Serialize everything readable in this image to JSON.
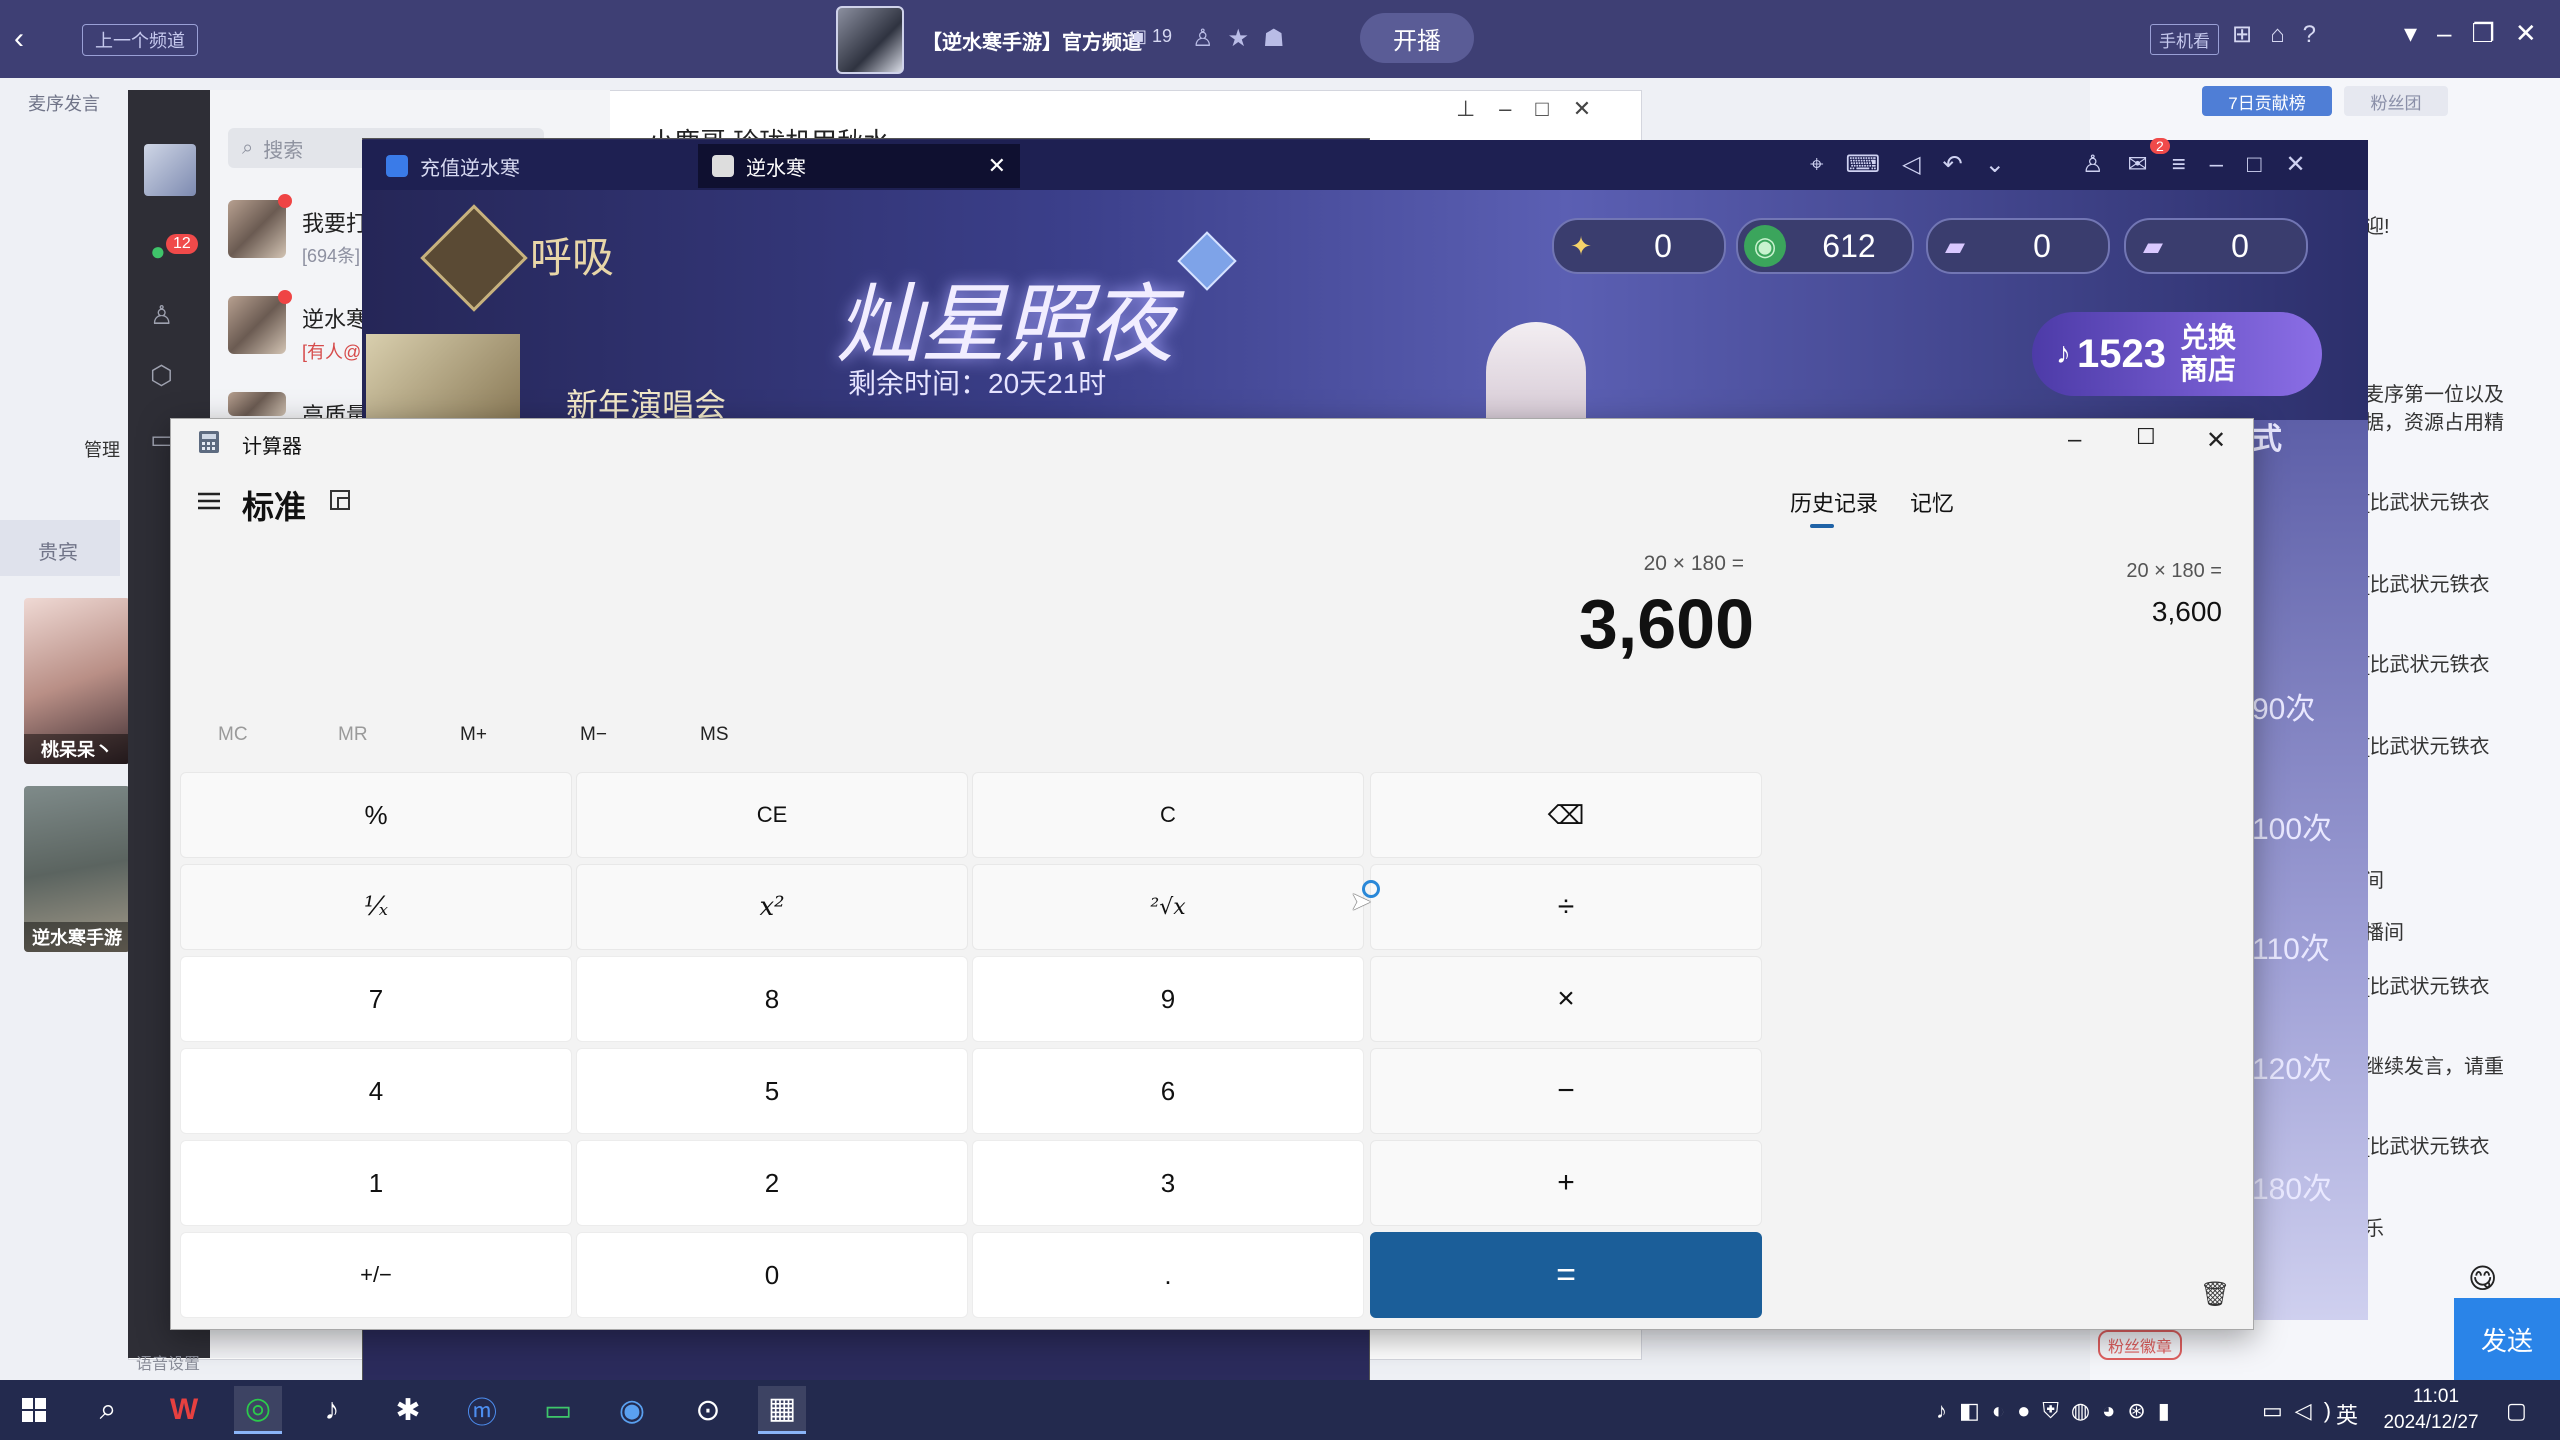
{
  "topbar": {
    "prev_channel": "上一个频道",
    "channel_title": "【逆水寒手游】官方频道",
    "channel_count": "19",
    "live_label": "开播",
    "mobile_label": "手机看"
  },
  "left_panel": {
    "speak_label": "麦序发言",
    "manage_label": "管理",
    "vip_label": "贵宾",
    "thumbs": [
      "桃呆呆丶",
      "逆水寒手游"
    ]
  },
  "messenger": {
    "search_placeholder": "搜索",
    "badge": "12",
    "items": [
      {
        "name": "我要打",
        "sub": "[694条]"
      },
      {
        "name": "逆水寒",
        "sub": "[有人@"
      },
      {
        "name": "高质量",
        "sub": ""
      }
    ],
    "chat_title": "小鹿哥 玲珑机甲秋水",
    "voice_settings": "语音设置"
  },
  "rightcol": {
    "tab_contrib": "7日贡献榜",
    "tab_fans": "粉丝团",
    "lines": [
      "迎!",
      "麦序第一位以及",
      "据，资源占用精",
      "[比武状元铁衣",
      "[比武状元铁衣",
      "[比武状元铁衣",
      "[比武状元铁衣",
      "间",
      "播间",
      "[比武状元铁衣",
      "继续发言，请重",
      "[比武状元铁衣",
      "乐"
    ],
    "fans_badge": "粉丝徽章",
    "send_label": "发送"
  },
  "game": {
    "tab_recharge": "充值逆水寒",
    "tab_game": "逆水寒",
    "mail_badge": "2",
    "banner_title": "灿星照夜",
    "banner_sub": "剩余时间：20天21时",
    "breath_label": "呼吸",
    "newyear_label": "新年演唱会",
    "right_label": "式",
    "currencies": [
      "0",
      "612",
      "0",
      "0"
    ],
    "shop_value": "1523",
    "shop_label_1": "兑换",
    "shop_label_2": "商店",
    "side_counts": [
      "90次",
      "100次",
      "110次",
      "120次",
      "180次"
    ]
  },
  "calculator": {
    "window_title": "计算器",
    "mode": "标准",
    "tab_history": "历史记录",
    "tab_memory": "记忆",
    "expression": "20 × 180 =",
    "result": "3,600",
    "memory_buttons": [
      "MC",
      "MR",
      "M+",
      "M−",
      "MS"
    ],
    "keys": [
      [
        "%",
        "CE",
        "C",
        "⌫"
      ],
      [
        "¹⁄ₓ",
        "x²",
        "²√x",
        "÷"
      ],
      [
        "7",
        "8",
        "9",
        "×"
      ],
      [
        "4",
        "5",
        "6",
        "−"
      ],
      [
        "1",
        "2",
        "3",
        "+"
      ],
      [
        "+/−",
        "0",
        ".",
        "="
      ]
    ],
    "history_expression": "20   ×   180 =",
    "history_result": "3,600"
  },
  "taskbar": {
    "time": "11:01",
    "date": "2024/12/27",
    "ime": "英"
  },
  "colors": {
    "accent": "#1b5e99",
    "topbar": "#3e3f74",
    "taskbar": "#232a4e"
  }
}
